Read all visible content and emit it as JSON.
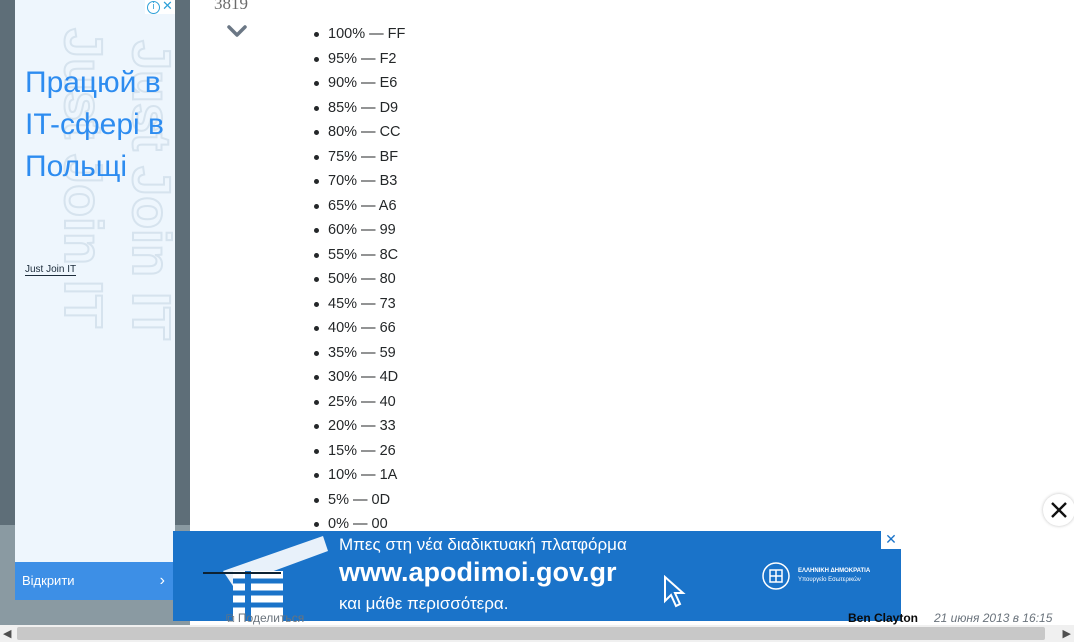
{
  "post": {
    "vote_count": "3819",
    "items": [
      "100% — FF",
      "95% — F2",
      "90% — E6",
      "85% — D9",
      "80% — CC",
      "75% — BF",
      "70% — B3",
      "65% — A6",
      "60% — 99",
      "55% — 8C",
      "50% — 80",
      "45% — 73",
      "40% — 66",
      "35% — 59",
      "30% — 4D",
      "25% — 40",
      "20% — 33",
      "15% — 26",
      "10% — 1A",
      "5% — 0D",
      "0% — 00"
    ],
    "share_label": "Поделиться",
    "author": "Ben Clayton",
    "date": "21 июня 2013 в 16:15"
  },
  "ad_left": {
    "headline": "Працюй в IT-сфері в Польщі",
    "brand": "Just Join IT",
    "watermark": "Just Join IT",
    "open_button": "Відкрити",
    "accent_color": "#2d8cf0"
  },
  "ad_bottom": {
    "line1": "Μπες στη νέα διαδικτυακή πλατφόρμα",
    "line2": "www.apodimoi.gov.gr",
    "line3": "και μάθε περισσότερα.",
    "gov_line1": "ΕΛΛΗΝΙΚΗ ΔΗΜΟΚΡΑΤΙΑ",
    "gov_line2": "Υπουργείο Εσωτερικών",
    "background_color": "#1a73c9"
  },
  "icons": {
    "vote_down": "chevron-down-icon",
    "close_overlay": "close-icon",
    "share": "share-icon",
    "ad_info": "info-icon"
  }
}
